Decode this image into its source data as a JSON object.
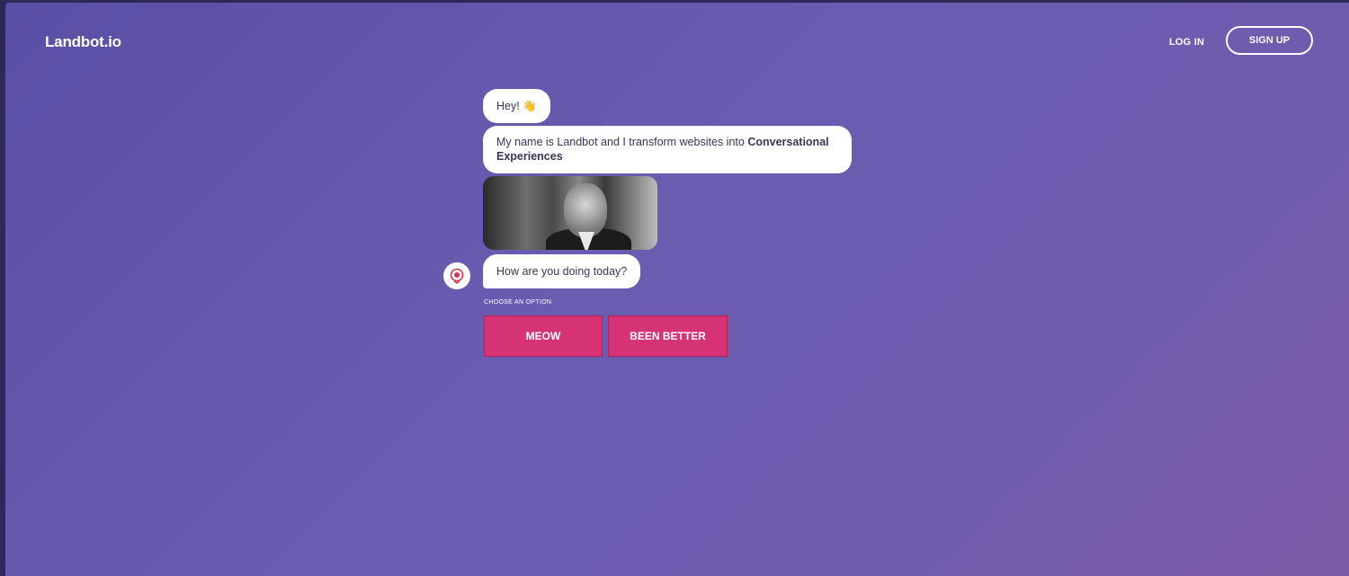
{
  "header": {
    "logo": "Landbot.io",
    "login_label": "LOG IN",
    "signup_label": "SIGN UP"
  },
  "chat": {
    "greeting": "Hey! 👋",
    "intro_text": "My name is Landbot and I transform websites into ",
    "intro_bold": "Conversational Experiences",
    "question": "How are you doing today?",
    "choose_label": "CHOOSE AN OPTION",
    "options": [
      "MEOW",
      "BEEN BETTER"
    ]
  },
  "colors": {
    "background": "#5e52aa",
    "option_button": "#d63374"
  },
  "icons": {
    "avatar": "bot-avatar-icon"
  }
}
